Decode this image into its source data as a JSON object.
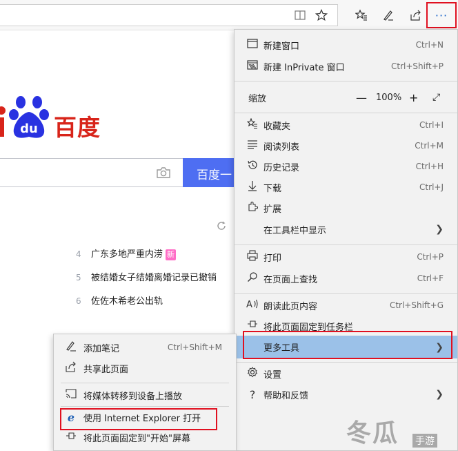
{
  "toolbar": {
    "icons": [
      "reading-view-icon",
      "favorite-star-icon",
      "favorites-hub-icon",
      "web-note-icon",
      "share-icon",
      "more-icon"
    ],
    "more_label": "···"
  },
  "page": {
    "logo_text": "百度",
    "logo_letters": "du",
    "search_button": "百度一",
    "hot_items": [
      {
        "index": "4",
        "text": "广东多地严重内涝",
        "badge": "新"
      },
      {
        "index": "5",
        "text": "被结婚女子结婚离婚记录已撤销",
        "badge": ""
      },
      {
        "index": "6",
        "text": "佐佐木希老公出轨",
        "badge": ""
      }
    ]
  },
  "menu": {
    "new_window": {
      "label": "新建窗口",
      "shortcut": "Ctrl+N"
    },
    "new_inprivate": {
      "label": "新建 InPrivate 窗口",
      "shortcut": "Ctrl+Shift+P"
    },
    "zoom": {
      "label": "缩放",
      "minus": "—",
      "value": "100%",
      "plus": "+",
      "full": "⤢"
    },
    "favorites": {
      "label": "收藏夹",
      "shortcut": "Ctrl+I"
    },
    "reading_list": {
      "label": "阅读列表",
      "shortcut": "Ctrl+M"
    },
    "history": {
      "label": "历史记录",
      "shortcut": "Ctrl+H"
    },
    "downloads": {
      "label": "下载",
      "shortcut": "Ctrl+J"
    },
    "extensions": {
      "label": "扩展"
    },
    "show_in_toolbar": {
      "label": "在工具栏中显示"
    },
    "print": {
      "label": "打印",
      "shortcut": "Ctrl+P"
    },
    "find": {
      "label": "在页面上查找",
      "shortcut": "Ctrl+F"
    },
    "read_aloud": {
      "label": "朗读此页内容",
      "shortcut": "Ctrl+Shift+G"
    },
    "pin_taskbar": {
      "label": "将此页面固定到任务栏"
    },
    "more_tools": {
      "label": "更多工具"
    },
    "settings": {
      "label": "设置"
    },
    "help": {
      "label": "帮助和反馈"
    }
  },
  "submenu": {
    "add_notes": {
      "label": "添加笔记",
      "shortcut": "Ctrl+Shift+M"
    },
    "share_page": {
      "label": "共享此页面"
    },
    "cast_media": {
      "label": "将媒体转移到设备上播放"
    },
    "open_ie": {
      "label": "使用 Internet Explorer 打开"
    },
    "pin_start": {
      "label": "将此页面固定到\"开始\"屏幕"
    }
  },
  "watermark": {
    "text": "冬瓜",
    "sub": "手游"
  },
  "colors": {
    "highlight": "#9bc1e8",
    "callout": "#e01020",
    "baidu_blue": "#2932e1",
    "baidu_red": "#d8241a",
    "search_button": "#4e6ef2"
  }
}
